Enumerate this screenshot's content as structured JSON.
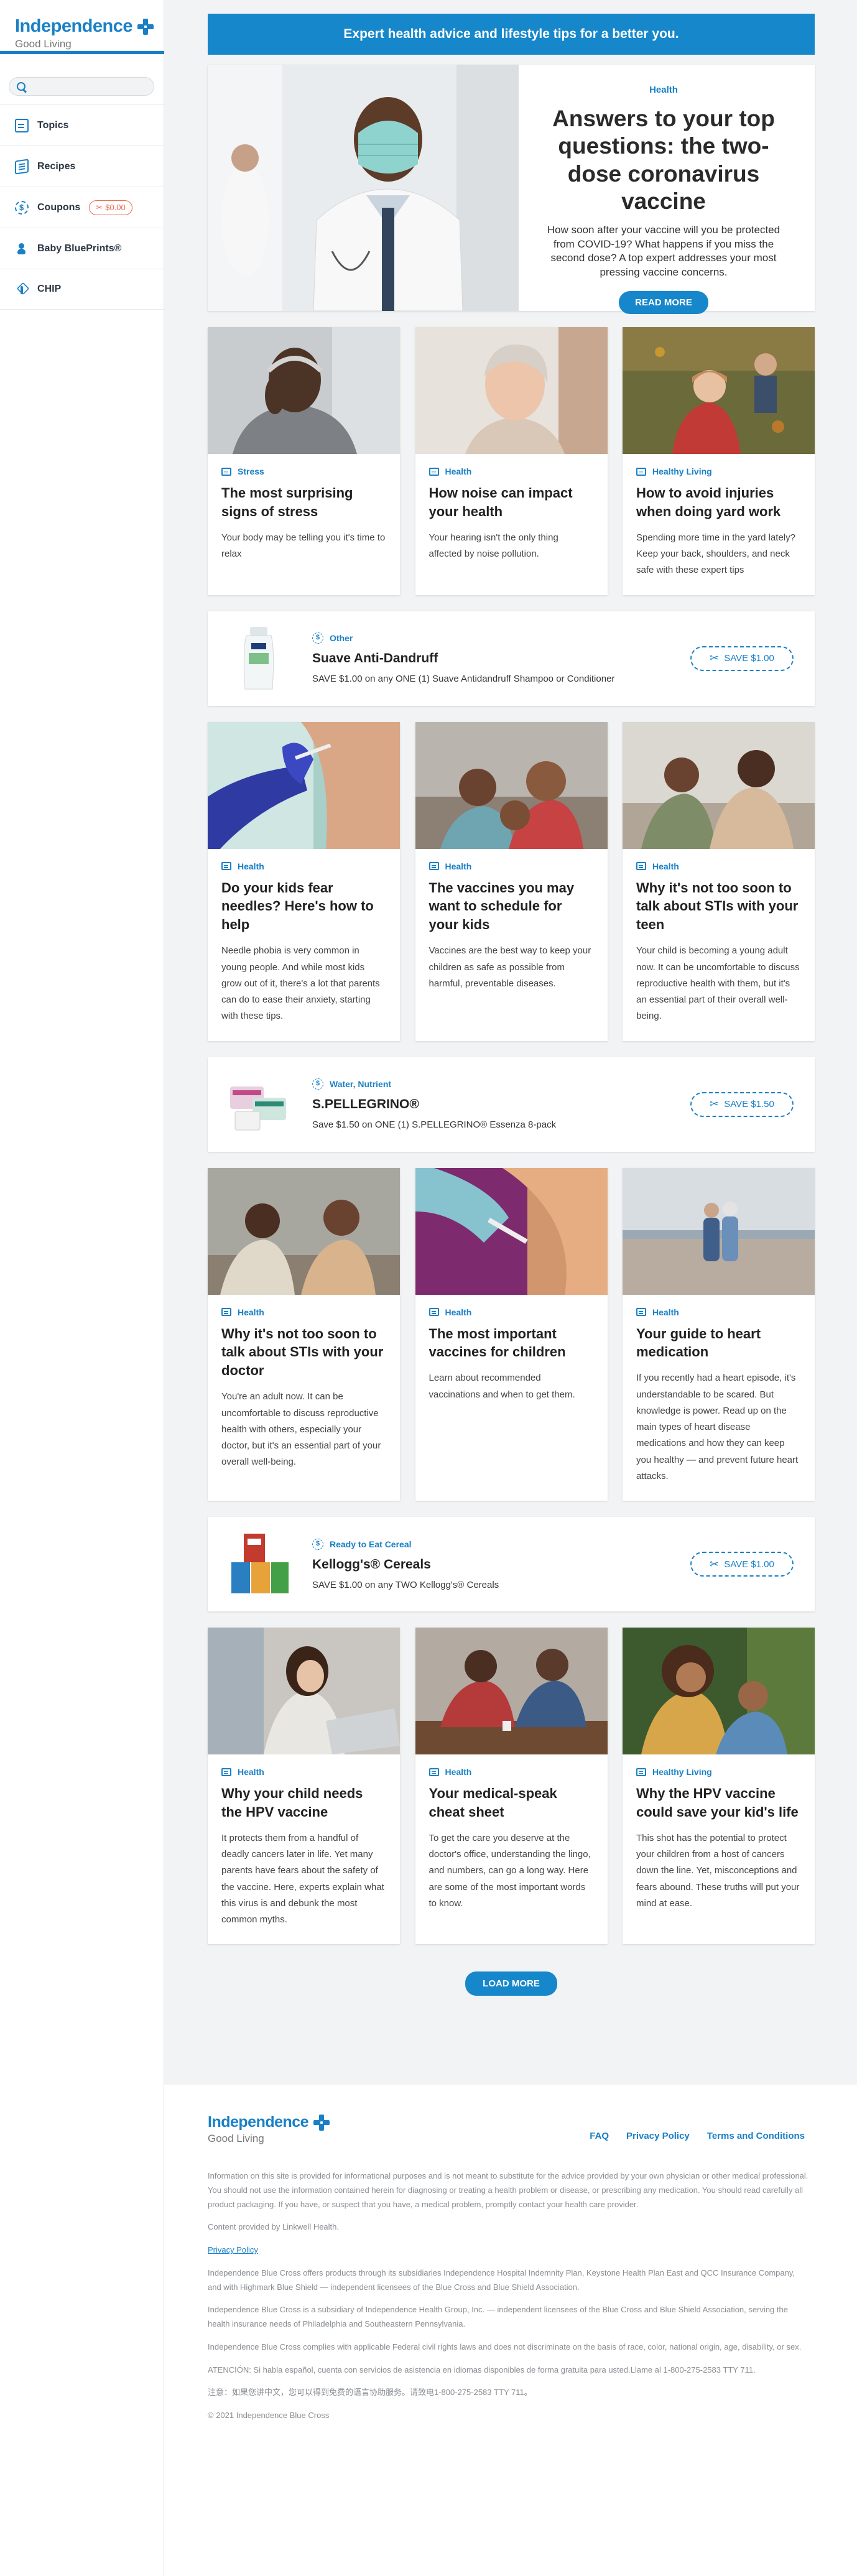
{
  "brand": {
    "name": "Independence",
    "tagline": "Good Living"
  },
  "search": {
    "placeholder": ""
  },
  "sidebar": {
    "items": [
      {
        "label": "Topics",
        "icon": "topics-icon"
      },
      {
        "label": "Recipes",
        "icon": "recipes-icon"
      },
      {
        "label": "Coupons",
        "icon": "coupons-icon",
        "badge": "$0.00"
      },
      {
        "label": "Baby BluePrints®",
        "icon": "baby-icon"
      },
      {
        "label": "CHIP",
        "icon": "chip-icon"
      }
    ]
  },
  "banner": "Expert health advice and lifestyle tips for a better you.",
  "hero": {
    "topic": "Health",
    "title": "Answers to your top questions: the two-dose coronavirus vaccine",
    "text": "How soon after your vaccine will you be protected from COVID-19? What happens if you miss the second dose? A top expert addresses your most pressing vaccine concerns.",
    "button": "READ MORE"
  },
  "rows": [
    [
      {
        "category": "Stress",
        "title": "The most surprising signs of stress",
        "text": "Your body may be telling you it's time to relax"
      },
      {
        "category": "Health",
        "title": "How noise can impact your health",
        "text": "Your hearing isn't the only thing affected by noise pollution."
      },
      {
        "category": "Healthy Living",
        "title": "How to avoid injuries when doing yard work",
        "text": "Spending more time in the yard lately? Keep your back, shoulders, and neck safe with these expert tips"
      }
    ],
    [
      {
        "category": "Health",
        "title": "Do your kids fear needles? Here's how to help",
        "text": "Needle phobia is very common in young people. And while most kids grow out of it, there's a lot that parents can do to ease their anxiety, starting with these tips."
      },
      {
        "category": "Health",
        "title": "The vaccines you may want to schedule for your kids",
        "text": "Vaccines are the best way to keep your children as safe as possible from harmful, preventable diseases."
      },
      {
        "category": "Health",
        "title": "Why it's not too soon to talk about STIs with your teen",
        "text": "Your child is becoming a young adult now. It can be uncomfortable to discuss reproductive health with them, but it's an essential part of their overall well-being."
      }
    ],
    [
      {
        "category": "Health",
        "title": "Why it's not too soon to talk about STIs with your doctor",
        "text": "You're an adult now. It can be uncomfortable to discuss reproductive health with others, especially your doctor, but it's an essential part of your overall well-being."
      },
      {
        "category": "Health",
        "title": "The most important vaccines for children",
        "text": "Learn about recommended vaccinations and when to get them."
      },
      {
        "category": "Health",
        "title": "Your guide to heart medication",
        "text": "If you recently had a heart episode, it's understandable to be scared. But knowledge is power. Read up on the main types of heart disease medications and how they can keep you healthy — and prevent future heart attacks."
      }
    ],
    [
      {
        "category": "Health",
        "title": "Why your child needs the HPV vaccine",
        "text": "It protects them from a handful of deadly cancers later in life. Yet many parents have fears about the safety of the vaccine. Here, experts explain what this virus is and debunk the most common myths."
      },
      {
        "category": "Health",
        "title": "Your medical-speak cheat sheet",
        "text": "To get the care you deserve at the doctor's office, understanding the lingo, and numbers, can go a long way. Here are some of the most important words to know."
      },
      {
        "category": "Healthy Living",
        "title": "Why the HPV vaccine could save your kid's life",
        "text": "This shot has the potential to protect your children from a host of cancers down the line. Yet, misconceptions and fears abound. These truths will put your mind at ease."
      }
    ]
  ],
  "coupons": [
    {
      "category": "Other",
      "title": "Suave Anti-Dandruff",
      "text": "SAVE $1.00 on any ONE (1) Suave Antidandruff Shampoo or Conditioner",
      "save": "SAVE $1.00"
    },
    {
      "category": "Water, Nutrient",
      "title": "S.PELLEGRINO®",
      "text": "Save $1.50 on ONE (1) S.PELLEGRINO® Essenza 8-pack",
      "save": "SAVE $1.50"
    },
    {
      "category": "Ready to Eat Cereal",
      "title": "Kellogg's® Cereals",
      "text": "SAVE $1.00 on any TWO Kellogg's® Cereals",
      "save": "SAVE $1.00"
    }
  ],
  "load_more": "LOAD MORE",
  "footer": {
    "links": [
      "FAQ",
      "Privacy Policy",
      "Terms and Conditions"
    ],
    "disclaimer": "Information on this site is provided for informational purposes and is not meant to substitute for the advice provided by your own physician or other medical professional. You should not use the information contained herein for diagnosing or treating a health problem or disease, or prescribing any medication. You should read carefully all product packaging. If you have, or suspect that you have, a medical problem, promptly contact your health care provider.",
    "content_by": "Content provided by Linkwell Health.",
    "privacy_link": "Privacy Policy",
    "p1": "Independence Blue Cross offers products through its subsidiaries Independence Hospital Indemnity Plan, Keystone Health Plan East and QCC Insurance Company, and with Highmark Blue Shield — independent licensees of the Blue Cross and Blue Shield Association.",
    "p2": "Independence Blue Cross is a subsidiary of Independence Health Group, Inc. — independent licensees of the Blue Cross and Blue Shield Association, serving the health insurance needs of Philadelphia and Southeastern Pennsylvania.",
    "p3": "Independence Blue Cross complies with applicable Federal civil rights laws and does not discriminate on the basis of race, color, national origin, age, disability, or sex.",
    "p4": "ATENCIÓN: Si habla español, cuenta con servicios de asistencia en idiomas disponibles de forma gratuita para usted.Llame al 1-800-275-2583 TTY 711.",
    "p5": "注意：如果您讲中文，您可以得到免费的语言协助服务。请致电1-800-275-2583 TTY 711。",
    "copyright": "© 2021 Independence Blue Cross"
  },
  "colors": {
    "accent": "#1687cb",
    "brand": "#1a80c6",
    "coupon_badge": "#e86a4f",
    "background": "#f2f3f4"
  }
}
